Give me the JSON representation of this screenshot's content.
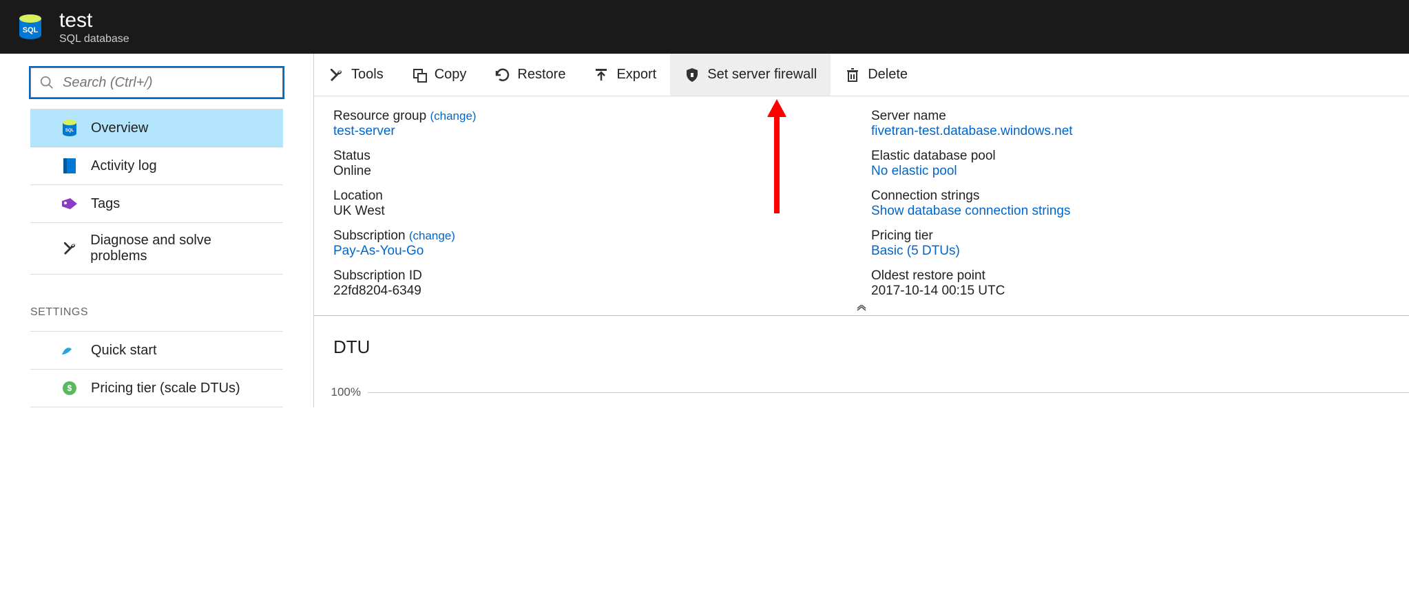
{
  "header": {
    "title": "test",
    "subtitle": "SQL database"
  },
  "search": {
    "placeholder": "Search (Ctrl+/)"
  },
  "sidebar": {
    "items": [
      {
        "label": "Overview",
        "icon": "sql-db-icon",
        "active": true
      },
      {
        "label": "Activity log",
        "icon": "log-icon"
      },
      {
        "label": "Tags",
        "icon": "tag-icon"
      },
      {
        "label": "Diagnose and solve problems",
        "icon": "tools-icon"
      }
    ],
    "section_label": "SETTINGS",
    "settings_items": [
      {
        "label": "Quick start",
        "icon": "quickstart-icon"
      },
      {
        "label": "Pricing tier (scale DTUs)",
        "icon": "pricing-icon"
      }
    ]
  },
  "toolbar": {
    "tools": "Tools",
    "copy": "Copy",
    "restore": "Restore",
    "export": "Export",
    "firewall": "Set server firewall",
    "delete": "Delete"
  },
  "details": {
    "resource_group_label": "Resource group",
    "resource_group_value": "test-server",
    "change_label": "(change)",
    "status_label": "Status",
    "status_value": "Online",
    "location_label": "Location",
    "location_value": "UK West",
    "subscription_label": "Subscription",
    "subscription_value": "Pay-As-You-Go",
    "subscription_id_label": "Subscription ID",
    "subscription_id_value": "22fd8204-6349",
    "server_name_label": "Server name",
    "server_name_value": "fivetran-test.database.windows.net",
    "elastic_label": "Elastic database pool",
    "elastic_value": "No elastic pool",
    "connstr_label": "Connection strings",
    "connstr_value": "Show database connection strings",
    "pricing_label": "Pricing tier",
    "pricing_value": "Basic (5 DTUs)",
    "restore_label": "Oldest restore point",
    "restore_value": "2017-10-14 00:15 UTC"
  },
  "chart": {
    "title": "DTU",
    "tick": "100%"
  },
  "chart_data": {
    "type": "line",
    "title": "DTU",
    "ylabel": "",
    "ylim": [
      0,
      100
    ],
    "series": [],
    "y_ticks": [
      "100%"
    ]
  }
}
